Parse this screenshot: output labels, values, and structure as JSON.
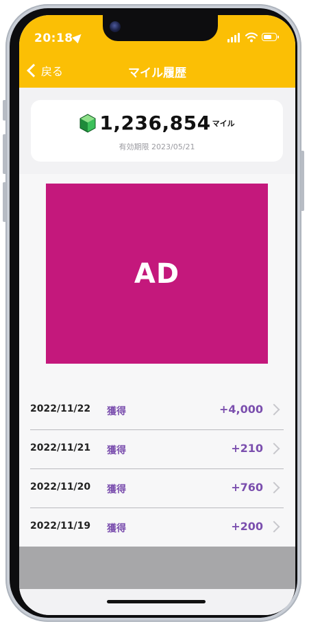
{
  "status_bar": {
    "time": "20:18"
  },
  "header": {
    "back_label": "戻る",
    "title": "マイル履歴"
  },
  "summary": {
    "miles": "1,236,854",
    "unit": "マイル",
    "expiry": "有効期限 2023/05/21"
  },
  "ad": {
    "label": "AD"
  },
  "history": [
    {
      "date": "2022/11/22",
      "type": "獲得",
      "amount": "+4,000"
    },
    {
      "date": "2022/11/21",
      "type": "獲得",
      "amount": "+210"
    },
    {
      "date": "2022/11/20",
      "type": "獲得",
      "amount": "+760"
    },
    {
      "date": "2022/11/19",
      "type": "獲得",
      "amount": "+200"
    }
  ],
  "colors": {
    "header": "#fbbf05",
    "accent_purple": "#7b4fae",
    "ad_background": "#c4187c",
    "gray_band": "#a7a7a9"
  },
  "icons": [
    "location-arrow-icon",
    "signal-icon",
    "wifi-icon",
    "battery-icon",
    "back-chevron-icon",
    "gem-icon",
    "chevron-right-icon"
  ]
}
